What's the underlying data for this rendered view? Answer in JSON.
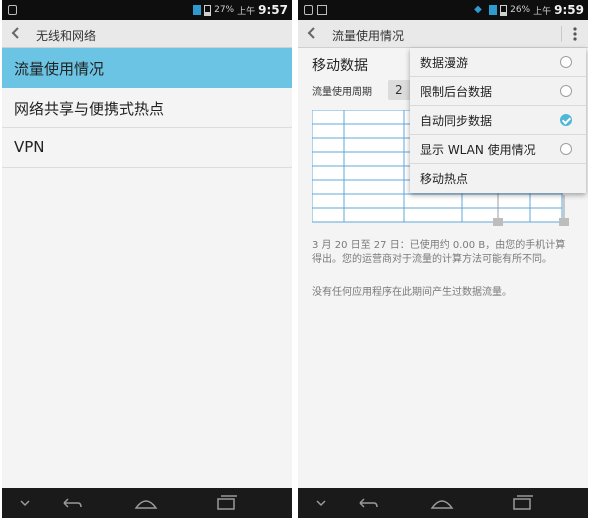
{
  "left": {
    "status": {
      "battery_pct": "27%",
      "ampm": "上午",
      "time": "9:57"
    },
    "title": "无线和网络",
    "items": [
      {
        "label": "流量使用情况",
        "selected": true
      },
      {
        "label": "网络共享与便携式热点",
        "selected": false
      },
      {
        "label": "VPN",
        "selected": false
      }
    ]
  },
  "right": {
    "status": {
      "battery_pct": "26%",
      "ampm": "上午",
      "time": "9:59"
    },
    "title": "流量使用情况",
    "mobile_data_label": "移动数据",
    "cycle_label": "流量使用周期",
    "cycle_value": "2",
    "usage_description": "3 月 20 日至 27 日：已使用约 0.00 B，由您的手机计算得出。您的运营商对于流量的计算方法可能有所不同。",
    "no_app_usage": "没有任何应用程序在此期间产生过数据流量。",
    "menu": [
      {
        "label": "数据漫游",
        "has_radio": true,
        "checked": false
      },
      {
        "label": "限制后台数据",
        "has_radio": true,
        "checked": false
      },
      {
        "label": "自动同步数据",
        "has_radio": true,
        "checked": true
      },
      {
        "label": "显示 WLAN 使用情况",
        "has_radio": true,
        "checked": false
      },
      {
        "label": "移动热点",
        "has_radio": false,
        "checked": false
      }
    ]
  },
  "colors": {
    "selected_item": "#6bc4e3",
    "accent": "#4fb6d6",
    "chart_grid": "#5fa8d8",
    "status_bar": "#0e0e0e",
    "nav_bar": "#1a1a1a"
  }
}
